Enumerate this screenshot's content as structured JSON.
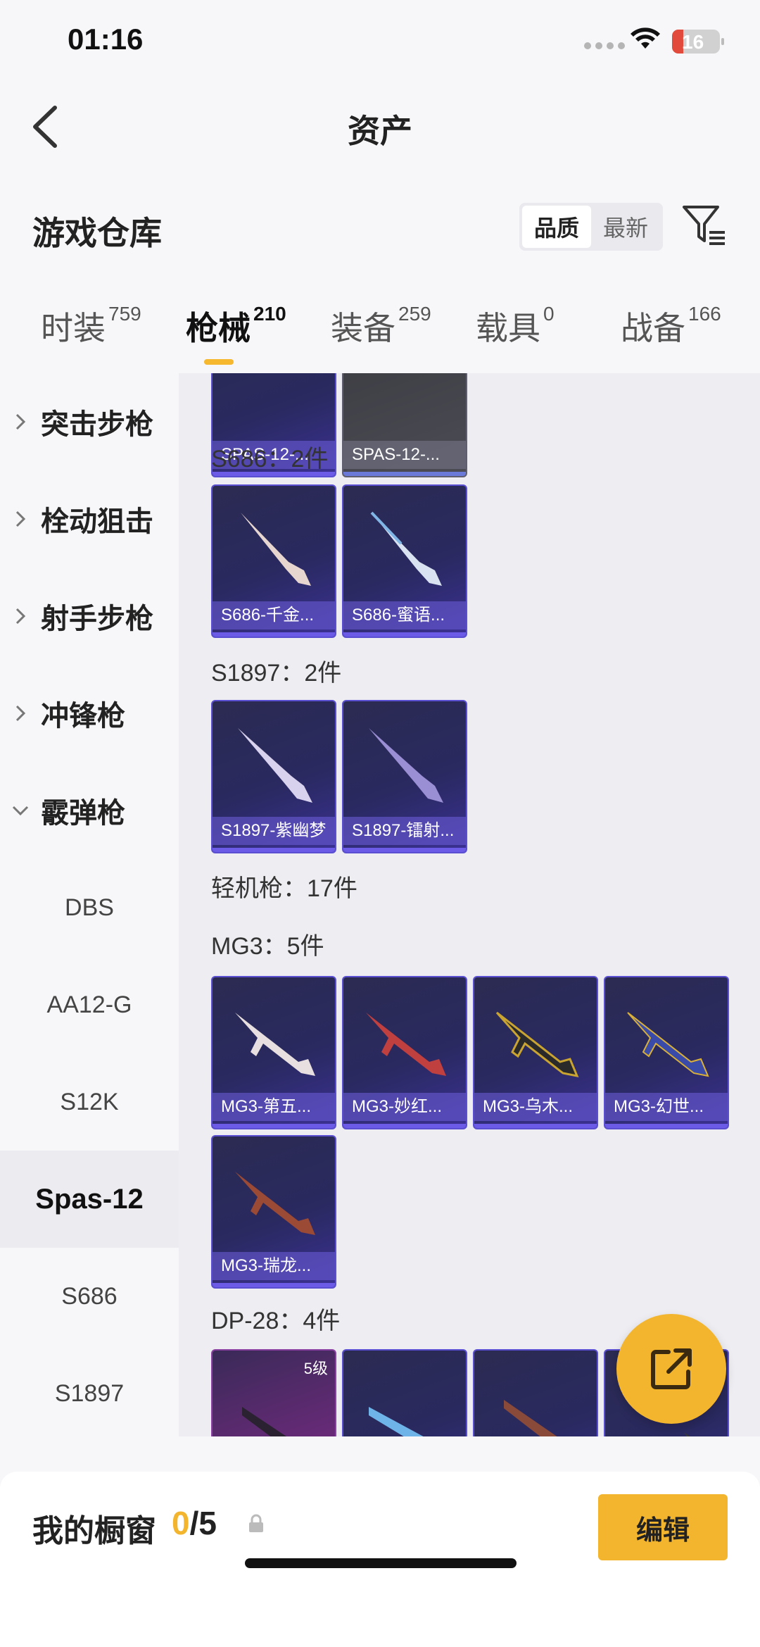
{
  "status_bar": {
    "time": "01:16",
    "battery": "16",
    "wifi_icon": "wifi-icon"
  },
  "nav": {
    "title": "资产",
    "back_icon": "chevron-left-icon"
  },
  "header": {
    "title": "游戏仓库",
    "sort_options": [
      "品质",
      "最新"
    ],
    "sort_selected": "品质",
    "filter_icon": "filter-icon"
  },
  "tabs": [
    {
      "label": "时装",
      "count": "759"
    },
    {
      "label": "枪械",
      "count": "210",
      "active": true
    },
    {
      "label": "装备",
      "count": "259"
    },
    {
      "label": "载具",
      "count": "0"
    },
    {
      "label": "战备",
      "count": "166"
    }
  ],
  "sidebar": {
    "categories": [
      {
        "label": "突击步枪",
        "expanded": false
      },
      {
        "label": "栓动狙击",
        "expanded": false
      },
      {
        "label": "射手步枪",
        "expanded": false
      },
      {
        "label": "冲锋枪",
        "expanded": false
      },
      {
        "label": "霰弹枪",
        "expanded": true
      }
    ],
    "subitems": [
      "DBS",
      "AA12-G",
      "S12K",
      "Spas-12",
      "S686",
      "S1897"
    ],
    "selected_subitem": "Spas-12"
  },
  "content": {
    "top_cards": [
      "SPAS-12-...",
      "SPAS-12-..."
    ],
    "groups": [
      {
        "label": "S686：2件",
        "items": [
          "S686-千金...",
          "S686-蜜语..."
        ]
      },
      {
        "label": "S1897：2件",
        "items": [
          "S1897-紫幽梦",
          "S1897-镭射..."
        ]
      },
      {
        "label": "轻机枪：17件"
      },
      {
        "label": "MG3：5件",
        "items": [
          "MG3-第五...",
          "MG3-妙红...",
          "MG3-乌木...",
          "MG3-幻世...",
          "MG3-瑞龙..."
        ]
      },
      {
        "label": "DP-28：4件",
        "first_item_level": "5级"
      }
    ]
  },
  "fab": {
    "icon": "share-icon"
  },
  "bottom": {
    "label": "我的橱窗",
    "current": "0",
    "total": "/5",
    "lock_icon": "lock-icon",
    "edit_label": "编辑"
  },
  "colors": {
    "accent": "#f3b52e",
    "card_purple": "#3b3194"
  }
}
